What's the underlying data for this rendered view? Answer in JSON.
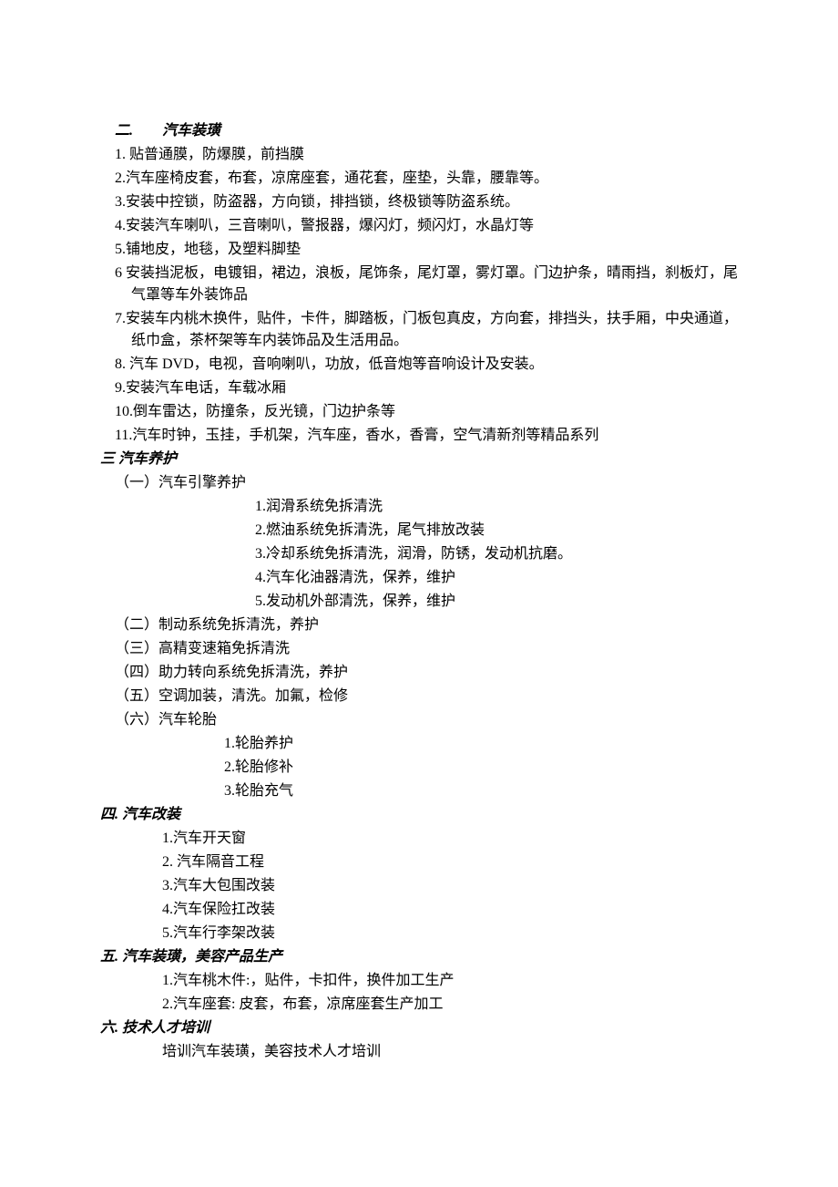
{
  "section2": {
    "heading": "二.　　汽车装璜",
    "items": [
      "1. 贴普通膜，防爆膜，前挡膜",
      "2.汽车座椅皮套，布套，凉席座套，通花套，座垫，头靠，腰靠等。",
      "3.安装中控锁，防盗器，方向锁，排挡锁，终极锁等防盗系统。",
      "4.安装汽车喇叭，三音喇叭，警报器，爆闪灯，频闪灯，水晶灯等",
      "5.铺地皮，地毯，及塑料脚垫",
      "6 安装挡泥板，电镀钼，裙边，浪板，尾饰条，尾灯罩，雾灯罩。门边护条，晴雨挡，刹板灯，尾气罩等车外装饰品",
      "7.安装车内桃木换件，贴件，卡件，脚踏板，门板包真皮，方向套，排挡头，扶手厢，中央通道，纸巾盒，茶杯架等车内装饰品及生活用品。",
      "8. 汽车 DVD，电视，音响喇叭，功放，低音炮等音响设计及安装。",
      "9.安装汽车电话，车载冰厢",
      "10.倒车雷达，防撞条，反光镜，门边护条等",
      "11.汽车时钟，玉挂，手机架，汽车座，香水，香膏，空气清新剂等精品系列"
    ]
  },
  "section3": {
    "heading": "三 汽车养护",
    "sub1": {
      "title": "（一）汽车引擎养护",
      "items": [
        "1.润滑系统免拆清洗",
        "2.燃油系统免拆清洗，尾气排放改装",
        "3.冷却系统免拆清洗，润滑，防锈，发动机抗磨。",
        "4.汽车化油器清洗，保养，维护",
        "5.发动机外部清洗，保养，维护"
      ]
    },
    "sub2": "（二）制动系统免拆清洗，养护",
    "sub3": "（三）高精变速箱免拆清洗",
    "sub4": "（四）助力转向系统免拆清洗，养护",
    "sub5": "（五）空调加装，清洗。加氟，检修",
    "sub6": {
      "title": "（六）汽车轮胎",
      "items": [
        "1.轮胎养护",
        "2.轮胎修补",
        "3.轮胎充气"
      ]
    }
  },
  "section4": {
    "heading": "四. 汽车改装",
    "items": [
      "1.汽车开天窗",
      "2. 汽车隔音工程",
      "3.汽车大包围改装",
      "4.汽车保险扛改装",
      "5.汽车行李架改装"
    ]
  },
  "section5": {
    "heading": "五. 汽车装璜，美容产品生产",
    "items": [
      "1.汽车桃木件:，贴件，卡扣件，换件加工生产",
      "2.汽车座套: 皮套，布套，凉席座套生产加工"
    ]
  },
  "section6": {
    "heading": "六. 技术人才培训",
    "body": "培训汽车装璜，美容技术人才培训"
  }
}
